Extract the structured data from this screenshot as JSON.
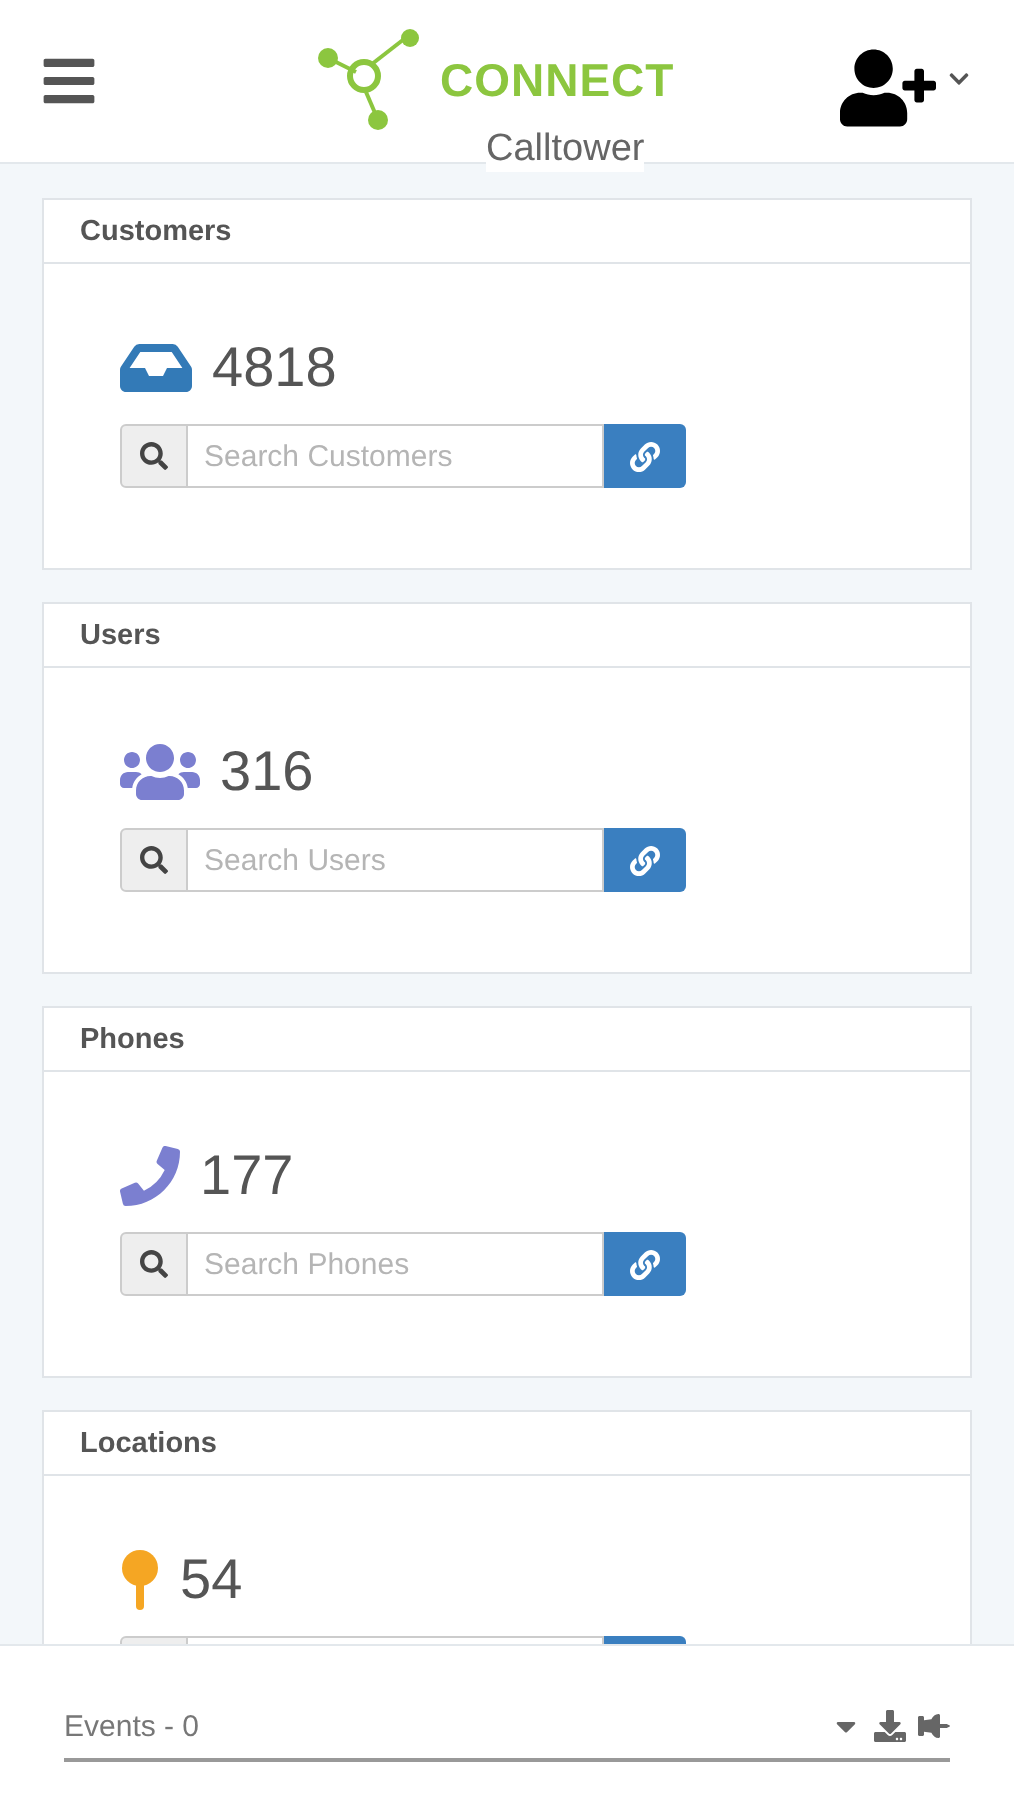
{
  "header": {
    "brand": "CONNECT",
    "tenant": "Calltower"
  },
  "cards": [
    {
      "title": "Customers",
      "kind": "inbox",
      "count": "4818",
      "placeholder": "Search Customers"
    },
    {
      "title": "Users",
      "kind": "users",
      "count": "316",
      "placeholder": "Search Users"
    },
    {
      "title": "Phones",
      "kind": "phone",
      "count": "177",
      "placeholder": "Search Phones"
    },
    {
      "title": "Locations",
      "kind": "pin",
      "count": "54"
    }
  ],
  "footer": {
    "events": "Events - 0"
  }
}
